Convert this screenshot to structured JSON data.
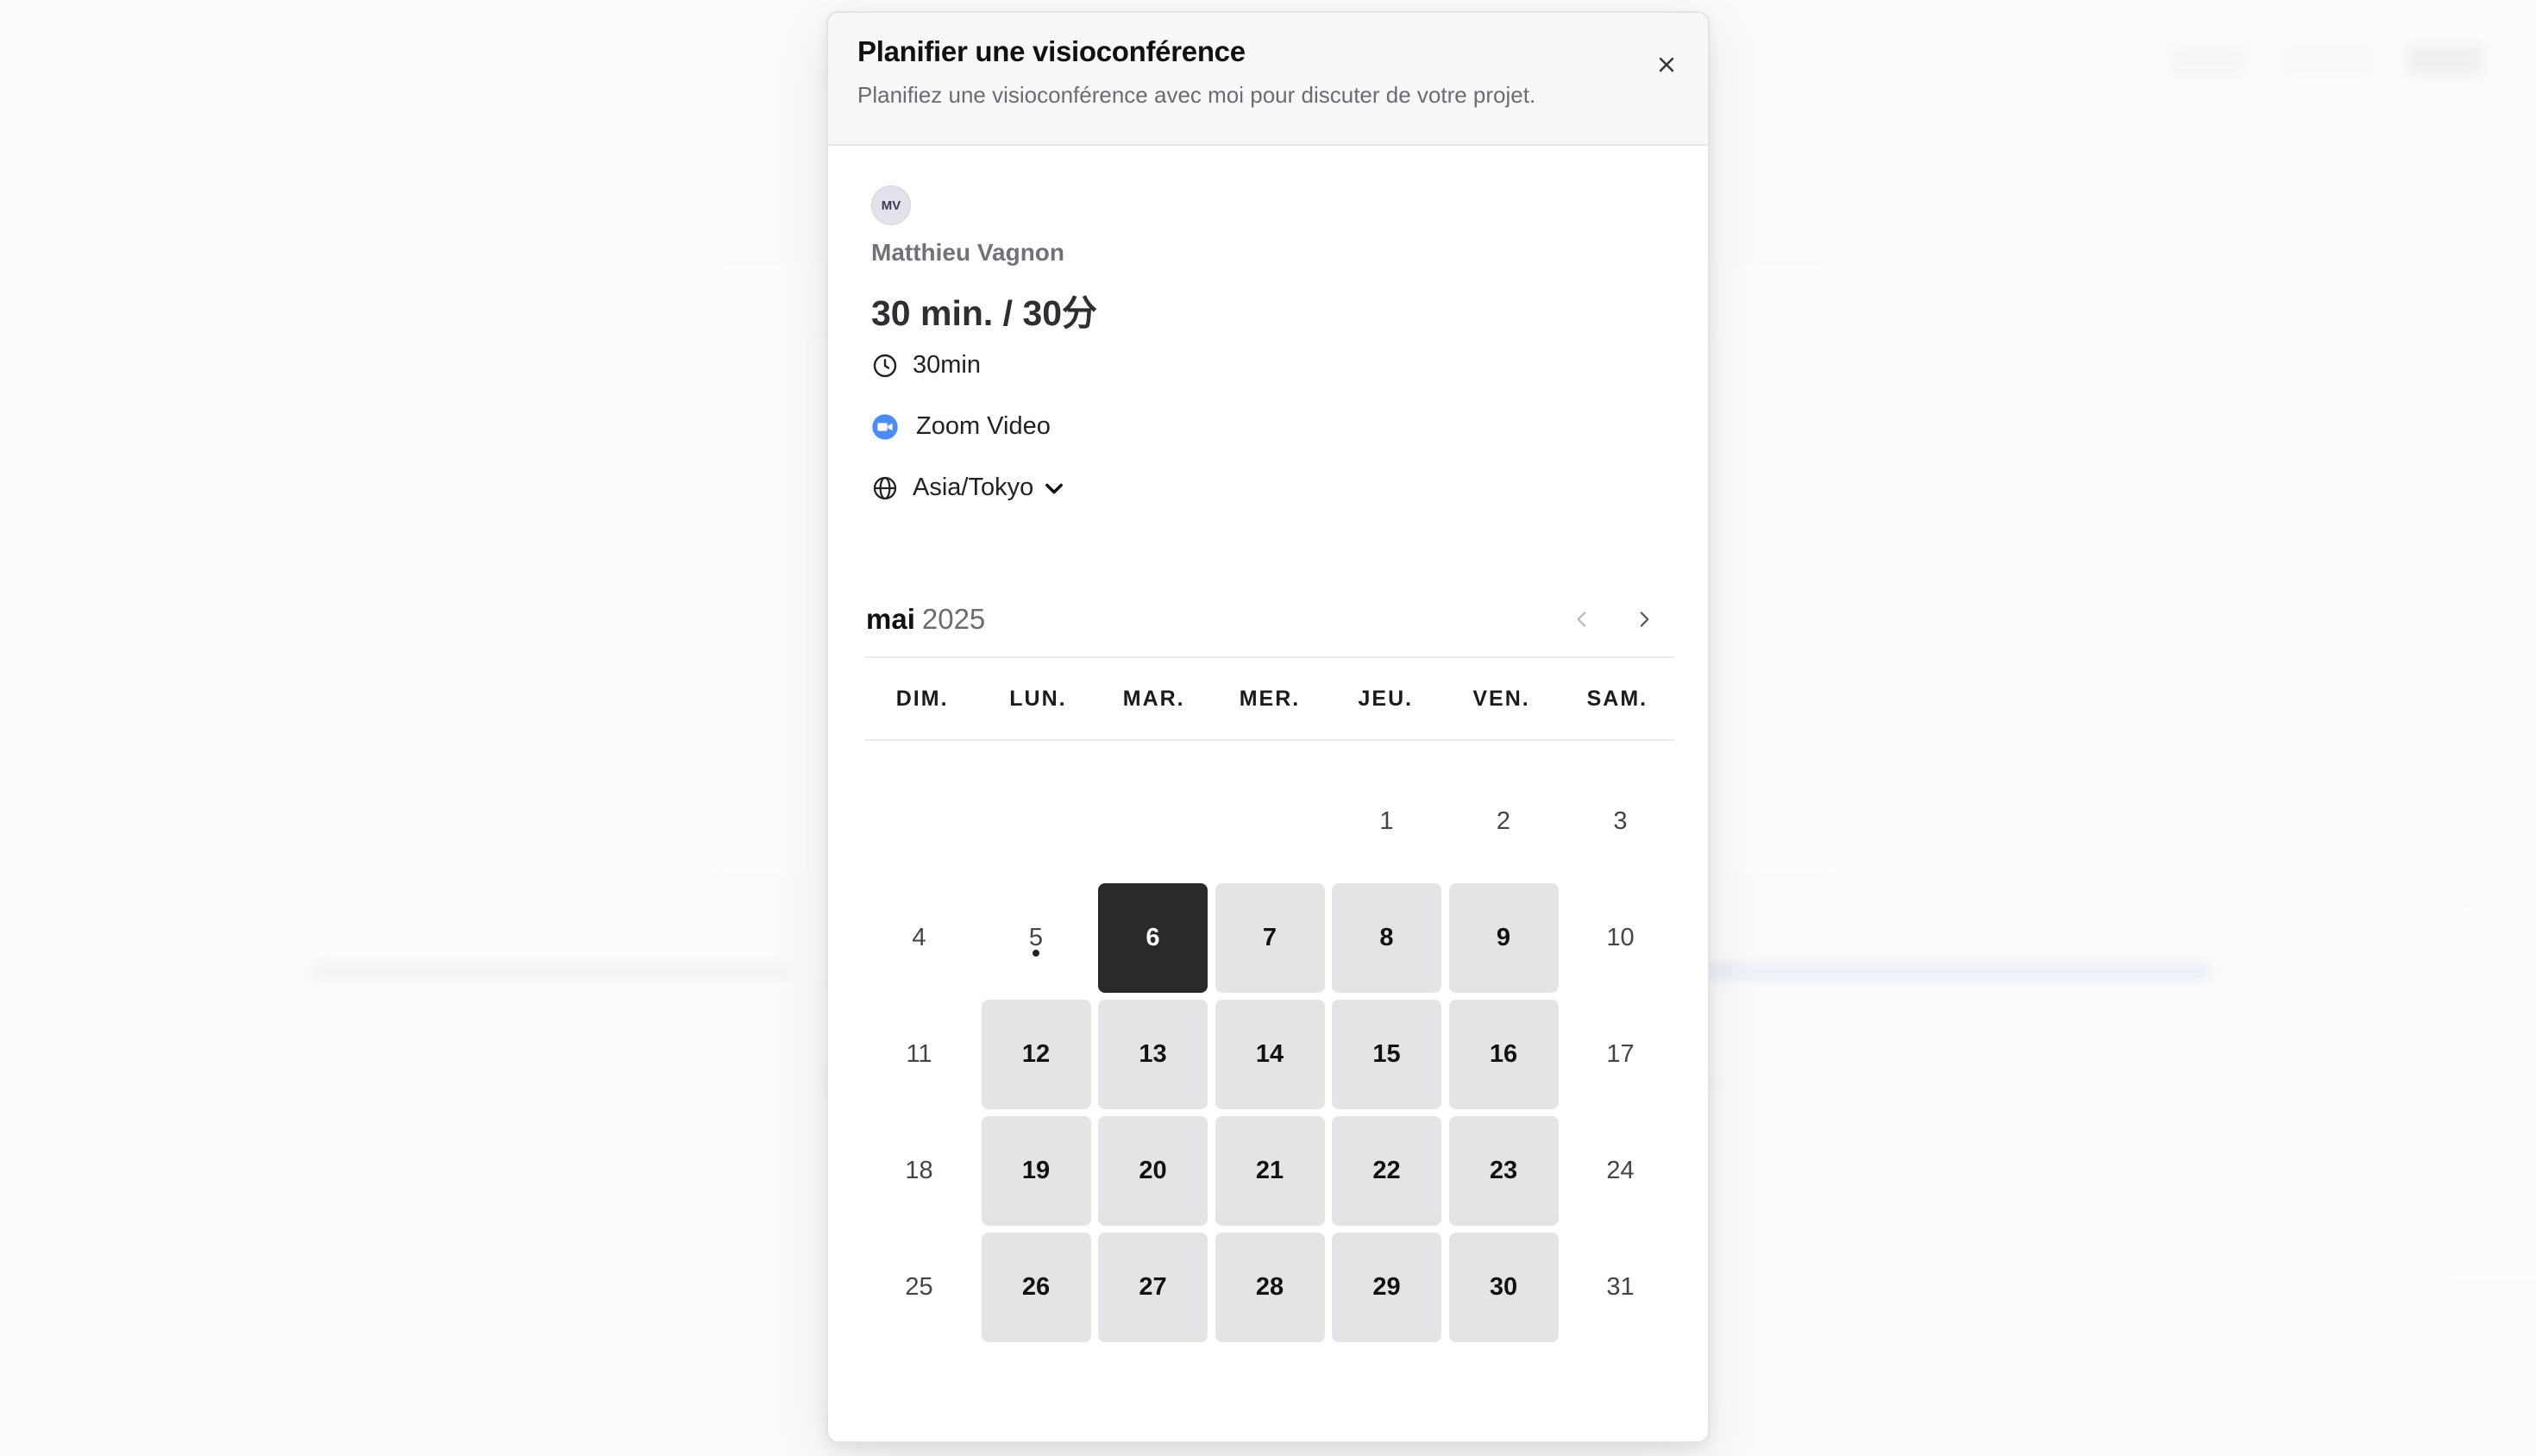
{
  "modal": {
    "title": "Planifier une visioconférence",
    "subtitle": "Planifiez une visioconférence avec moi pour discuter de votre projet."
  },
  "profile": {
    "avatar_initials": "MV",
    "host_name": "Matthieu Vagnon",
    "event_title": "30 min. / 30分",
    "duration": "30min",
    "location": "Zoom Video",
    "timezone": "Asia/Tokyo"
  },
  "icons": {
    "close": "close-icon",
    "clock": "clock-icon",
    "zoom": "zoom-video-icon",
    "globe": "globe-icon",
    "chevron_down": "chevron-down-icon",
    "prev": "chevron-left-icon",
    "next": "chevron-right-icon"
  },
  "colors": {
    "selected_day": "#2a2a2a",
    "available_day": "#e4e4e7",
    "zoom_blue": "#4a8cff"
  },
  "calendar": {
    "month": "mai",
    "year": "2025",
    "weekdays": [
      "DIM.",
      "LUN.",
      "MAR.",
      "MER.",
      "JEU.",
      "VEN.",
      "SAM."
    ],
    "weeks": [
      [
        null,
        null,
        null,
        null,
        {
          "n": "1",
          "s": "plain"
        },
        {
          "n": "2",
          "s": "plain"
        },
        {
          "n": "3",
          "s": "plain"
        }
      ],
      [
        {
          "n": "4",
          "s": "plain"
        },
        {
          "n": "5",
          "s": "plain",
          "today": true
        },
        {
          "n": "6",
          "s": "selected"
        },
        {
          "n": "7",
          "s": "available"
        },
        {
          "n": "8",
          "s": "available"
        },
        {
          "n": "9",
          "s": "available"
        },
        {
          "n": "10",
          "s": "plain"
        }
      ],
      [
        {
          "n": "11",
          "s": "plain"
        },
        {
          "n": "12",
          "s": "available"
        },
        {
          "n": "13",
          "s": "available"
        },
        {
          "n": "14",
          "s": "available"
        },
        {
          "n": "15",
          "s": "available"
        },
        {
          "n": "16",
          "s": "available"
        },
        {
          "n": "17",
          "s": "plain"
        }
      ],
      [
        {
          "n": "18",
          "s": "plain"
        },
        {
          "n": "19",
          "s": "available"
        },
        {
          "n": "20",
          "s": "available"
        },
        {
          "n": "21",
          "s": "available"
        },
        {
          "n": "22",
          "s": "available"
        },
        {
          "n": "23",
          "s": "available"
        },
        {
          "n": "24",
          "s": "plain"
        }
      ],
      [
        {
          "n": "25",
          "s": "plain"
        },
        {
          "n": "26",
          "s": "available"
        },
        {
          "n": "27",
          "s": "available"
        },
        {
          "n": "28",
          "s": "available"
        },
        {
          "n": "29",
          "s": "available"
        },
        {
          "n": "30",
          "s": "available"
        },
        {
          "n": "31",
          "s": "plain"
        }
      ]
    ]
  }
}
